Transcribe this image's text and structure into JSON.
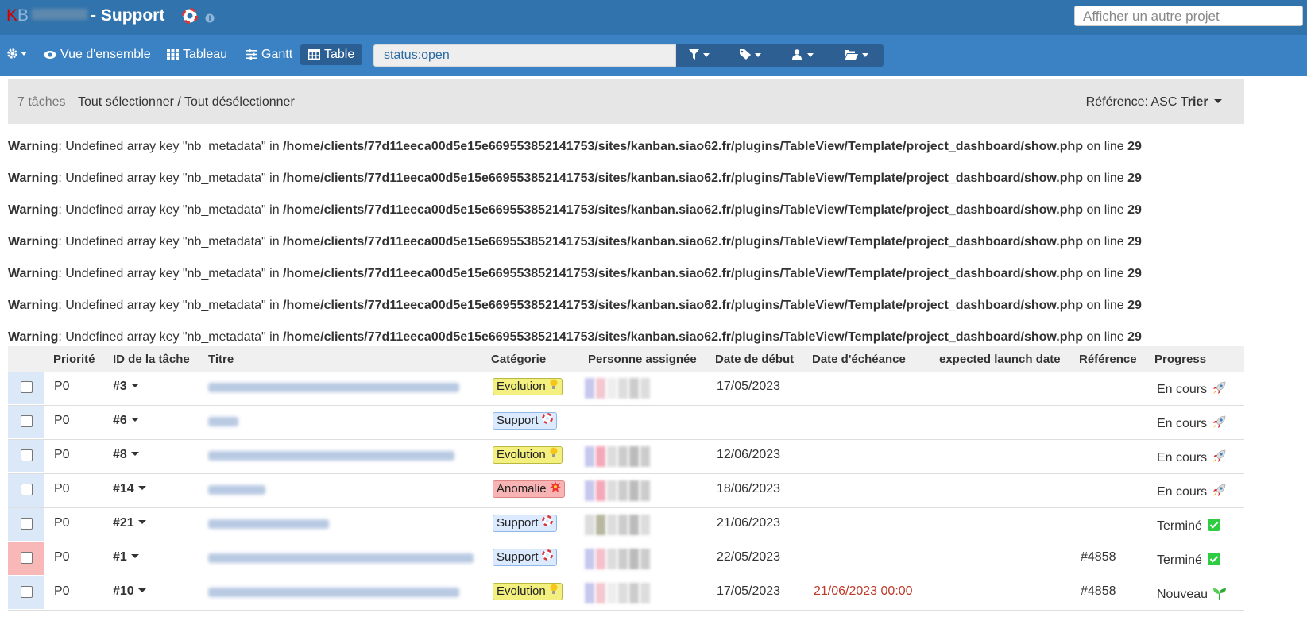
{
  "header": {
    "logo_k": "K",
    "logo_b": "B",
    "project_title": "- Support",
    "other_project_placeholder": "Afficher un autre projet"
  },
  "nav": {
    "overview": "Vue d'ensemble",
    "board": "Tableau",
    "gantt": "Gantt",
    "table": "Table",
    "filter_value": "status:open"
  },
  "selection": {
    "count": "7 tâches",
    "select_all": "Tout sélectionner / Tout désélectionner",
    "sort_label": "Référence: ASC",
    "sort_button": "Trier"
  },
  "warnings": [
    {
      "label": "Warning",
      "msg": ": Undefined array key \"nb_metadata\" in ",
      "path": "/home/clients/77d11eeca00d5e15e669553852141753/sites/kanban.siao62.fr/plugins/TableView/Template/project_dashboard/show.php",
      "line_text": " on line ",
      "line": "29"
    },
    {
      "label": "Warning",
      "msg": ": Undefined array key \"nb_metadata\" in ",
      "path": "/home/clients/77d11eeca00d5e15e669553852141753/sites/kanban.siao62.fr/plugins/TableView/Template/project_dashboard/show.php",
      "line_text": " on line ",
      "line": "29"
    },
    {
      "label": "Warning",
      "msg": ": Undefined array key \"nb_metadata\" in ",
      "path": "/home/clients/77d11eeca00d5e15e669553852141753/sites/kanban.siao62.fr/plugins/TableView/Template/project_dashboard/show.php",
      "line_text": " on line ",
      "line": "29"
    },
    {
      "label": "Warning",
      "msg": ": Undefined array key \"nb_metadata\" in ",
      "path": "/home/clients/77d11eeca00d5e15e669553852141753/sites/kanban.siao62.fr/plugins/TableView/Template/project_dashboard/show.php",
      "line_text": " on line ",
      "line": "29"
    },
    {
      "label": "Warning",
      "msg": ": Undefined array key \"nb_metadata\" in ",
      "path": "/home/clients/77d11eeca00d5e15e669553852141753/sites/kanban.siao62.fr/plugins/TableView/Template/project_dashboard/show.php",
      "line_text": " on line ",
      "line": "29"
    },
    {
      "label": "Warning",
      "msg": ": Undefined array key \"nb_metadata\" in ",
      "path": "/home/clients/77d11eeca00d5e15e669553852141753/sites/kanban.siao62.fr/plugins/TableView/Template/project_dashboard/show.php",
      "line_text": " on line ",
      "line": "29"
    },
    {
      "label": "Warning",
      "msg": ": Undefined array key \"nb_metadata\" in ",
      "path": "/home/clients/77d11eeca00d5e15e669553852141753/sites/kanban.siao62.fr/plugins/TableView/Template/project_dashboard/show.php",
      "line_text": " on line ",
      "line": "29"
    }
  ],
  "table": {
    "columns": {
      "priority": "Priorité",
      "id": "ID de la tâche",
      "title": "Titre",
      "category": "Catégorie",
      "assignee": "Personne assignée",
      "start": "Date de début",
      "due": "Date d'échéance",
      "launch": "expected launch date",
      "reference": "Référence",
      "progress": "Progress"
    },
    "rows": [
      {
        "priority": "P0",
        "id": "#3",
        "category": "Evolution",
        "start": "17/05/2023",
        "due": "",
        "reference": "",
        "progress": "En cours"
      },
      {
        "priority": "P0",
        "id": "#6",
        "category": "Support",
        "start": "",
        "due": "",
        "reference": "",
        "progress": "En cours"
      },
      {
        "priority": "P0",
        "id": "#8",
        "category": "Evolution",
        "start": "12/06/2023",
        "due": "",
        "reference": "",
        "progress": "En cours"
      },
      {
        "priority": "P0",
        "id": "#14",
        "category": "Anomalie",
        "start": "18/06/2023",
        "due": "",
        "reference": "",
        "progress": "En cours"
      },
      {
        "priority": "P0",
        "id": "#21",
        "category": "Support",
        "start": "21/06/2023",
        "due": "",
        "reference": "",
        "progress": "Terminé"
      },
      {
        "priority": "P0",
        "id": "#1",
        "category": "Support",
        "start": "22/05/2023",
        "due": "",
        "reference": "#4858",
        "progress": "Terminé"
      },
      {
        "priority": "P0",
        "id": "#10",
        "category": "Evolution",
        "start": "17/05/2023",
        "due": "21/06/2023 00:00",
        "reference": "#4858",
        "progress": "Nouveau"
      }
    ]
  }
}
